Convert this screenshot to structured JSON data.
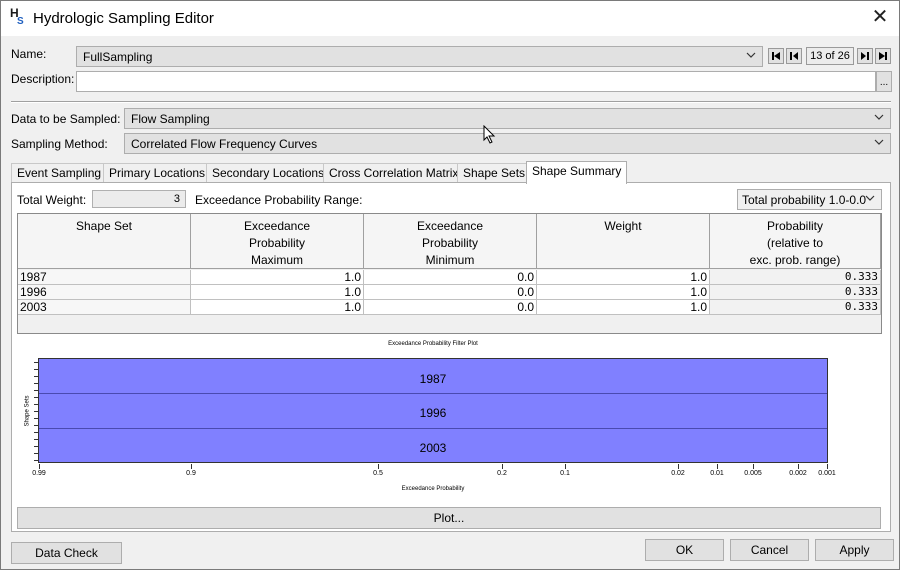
{
  "window": {
    "title": "Hydrologic Sampling Editor",
    "icon": "hs-app-icon",
    "icon_text_h": "H",
    "icon_text_s": "S",
    "close_glyph": "✕"
  },
  "form": {
    "name_label": "Name:",
    "name_value": "FullSampling",
    "description_label": "Description:",
    "description_value": "",
    "description_btn": "...",
    "data_sampled_label": "Data to be Sampled:",
    "data_sampled_value": "Flow Sampling",
    "sampling_method_label": "Sampling Method:",
    "sampling_method_value": "Correlated Flow Frequency Curves"
  },
  "nav": {
    "record_counter": "13 of 26"
  },
  "tabs": [
    {
      "label": "Event Sampling"
    },
    {
      "label": "Primary Locations"
    },
    {
      "label": "Secondary Locations"
    },
    {
      "label": "Cross Correlation Matrix"
    },
    {
      "label": "Shape Sets"
    },
    {
      "label": "Shape Summary"
    }
  ],
  "active_tab": "Shape Summary",
  "summary": {
    "total_weight_label": "Total Weight:",
    "total_weight_value": "3",
    "exceedance_range_label": "Exceedance Probability Range:",
    "range_dropdown_value": "Total probability 1.0-0.0"
  },
  "table": {
    "headers": [
      {
        "line1": "Shape Set",
        "line2": "",
        "line3": ""
      },
      {
        "line1": "Exceedance",
        "line2": "Probability",
        "line3": "Maximum"
      },
      {
        "line1": "Exceedance",
        "line2": "Probability",
        "line3": "Minimum"
      },
      {
        "line1": "Weight",
        "line2": "",
        "line3": ""
      },
      {
        "line1": "Probability",
        "line2": "(relative to",
        "line3": "exc. prob. range)"
      }
    ],
    "rows": [
      {
        "set": "1987",
        "max": "1.0",
        "min": "0.0",
        "weight": "1.0",
        "prob": "0.333"
      },
      {
        "set": "1996",
        "max": "1.0",
        "min": "0.0",
        "weight": "1.0",
        "prob": "0.333"
      },
      {
        "set": "2003",
        "max": "1.0",
        "min": "0.0",
        "weight": "1.0",
        "prob": "0.333"
      }
    ]
  },
  "plot": {
    "title": "Exceedance Probability Filter Plot",
    "ylabel": "Shape Sets",
    "xlabel": "Exceedance Probability",
    "bands": [
      "1987",
      "1996",
      "2003"
    ],
    "x_ticks": [
      "0.99",
      "0.9",
      "0.5",
      "0.2",
      "0.1",
      "0.02",
      "0.01",
      "0.005",
      "0.002",
      "0.001"
    ],
    "fill_color": "#8080ff"
  },
  "buttons": {
    "plot": "Plot...",
    "data_check": "Data Check",
    "ok": "OK",
    "cancel": "Cancel",
    "apply": "Apply"
  }
}
